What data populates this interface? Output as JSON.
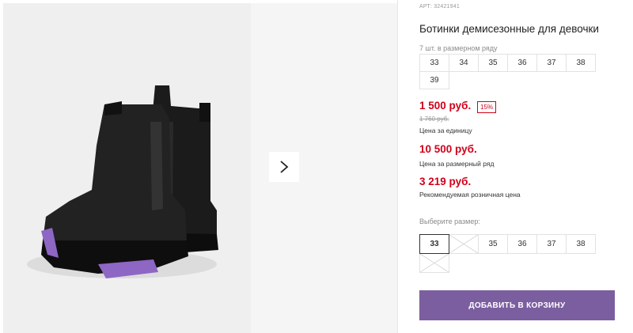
{
  "product": {
    "sku": "АРТ: 32421941",
    "title": "Ботинки демисезонные для девочки",
    "image_icon": "boots-photo"
  },
  "gallery": {
    "next_icon": "chevron-right-icon"
  },
  "pack": {
    "note": "7 шт. в размерном ряду",
    "sizes": [
      "33",
      "34",
      "35",
      "36",
      "37",
      "38",
      "39"
    ]
  },
  "prices": {
    "unit_price": "1 500 руб.",
    "discount": "15%",
    "old_price": "1 760 руб.",
    "unit_caption": "Цена за единицу",
    "row_price": "10 500 руб.",
    "row_caption": "Цена за размерный ряд",
    "rrp_price": "3 219 руб.",
    "rrp_caption": "Рекомендуемая розничная цена"
  },
  "size_picker": {
    "label": "Выберите размер:",
    "sizes": [
      {
        "label": "33",
        "state": "selected"
      },
      {
        "label": "",
        "state": "disabled"
      },
      {
        "label": "35",
        "state": "available"
      },
      {
        "label": "36",
        "state": "available"
      },
      {
        "label": "37",
        "state": "available"
      },
      {
        "label": "38",
        "state": "available"
      },
      {
        "label": "",
        "state": "disabled"
      }
    ]
  },
  "cart": {
    "add_label": "ДОБАВИТЬ В КОРЗИНУ"
  },
  "colors": {
    "accent": "#7b5ea0",
    "price_red": "#d0021b",
    "sole_purple": "#8e66c4"
  }
}
